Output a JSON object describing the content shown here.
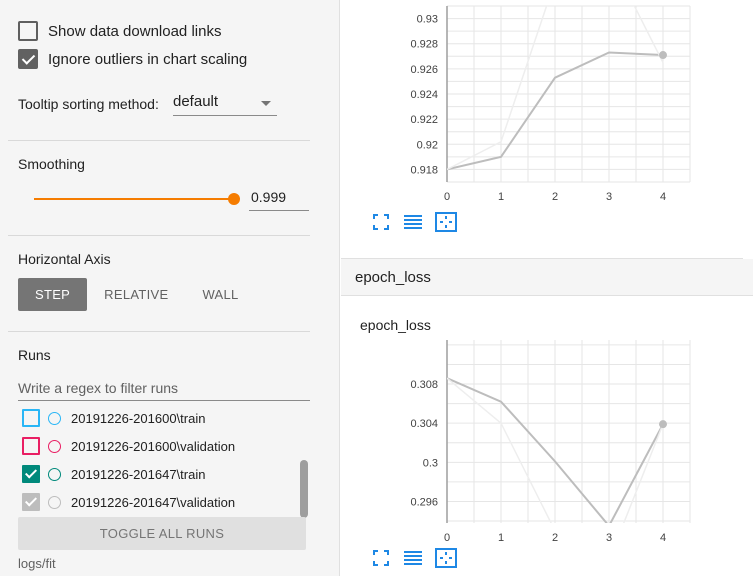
{
  "sidebar": {
    "show_download_label": "Show data download links",
    "ignore_outliers_label": "Ignore outliers in chart scaling",
    "tooltip_label": "Tooltip sorting method:",
    "tooltip_value": "default",
    "smoothing_title": "Smoothing",
    "smoothing_value": "0.999",
    "smoothing_fraction": 0.999,
    "horizontal_axis_title": "Horizontal Axis",
    "axis_buttons": [
      "STEP",
      "RELATIVE",
      "WALL"
    ],
    "axis_selected": "STEP",
    "runs_title": "Runs",
    "runs_filter_placeholder": "Write a regex to filter runs",
    "runs": [
      {
        "name": "20191226-201600\\train",
        "color": "#29b6f6",
        "checked": false
      },
      {
        "name": "20191226-201600\\validation",
        "color": "#e91e63",
        "checked": false
      },
      {
        "name": "20191226-201647\\train",
        "color": "#00897b",
        "checked": true
      },
      {
        "name": "20191226-201647\\validation",
        "color": "#bdbdbd",
        "checked": true
      }
    ],
    "toggle_all_label": "TOGGLE ALL RUNS",
    "logdir": "logs/fit"
  },
  "main": {
    "group_title": "epoch_loss",
    "card_title": "epoch_loss"
  },
  "colors": {
    "accent": "#f57c00",
    "icon_blue": "#1e88e5",
    "line": "#bdbdbd"
  },
  "chart_data": [
    {
      "type": "line",
      "title": "",
      "x": [
        0,
        1,
        2,
        3,
        4
      ],
      "xlabel": "",
      "ylabel": "",
      "yticks": [
        0.918,
        0.92,
        0.922,
        0.924,
        0.926,
        0.928,
        0.93
      ],
      "ylim": [
        0.917,
        0.931
      ],
      "series": [
        {
          "values": [
            0.918,
            0.919,
            0.9253,
            0.9273,
            0.9271
          ],
          "style": "smoothed"
        },
        {
          "values": [
            0.918,
            0.9202,
            0.933,
            0.935,
            0.9265
          ],
          "style": "raw"
        }
      ]
    },
    {
      "type": "line",
      "title": "epoch_loss",
      "x": [
        0,
        1,
        2,
        3,
        4
      ],
      "xlabel": "",
      "ylabel": "",
      "yticks": [
        0.296,
        0.3,
        0.304,
        0.308
      ],
      "ylim": [
        0.2938,
        0.3125
      ],
      "series": [
        {
          "values": [
            0.3086,
            0.3062,
            0.3001,
            0.2935,
            0.3039
          ],
          "style": "smoothed"
        },
        {
          "values": [
            0.3086,
            0.304,
            0.293,
            0.29,
            0.3039
          ],
          "style": "raw"
        }
      ]
    }
  ]
}
